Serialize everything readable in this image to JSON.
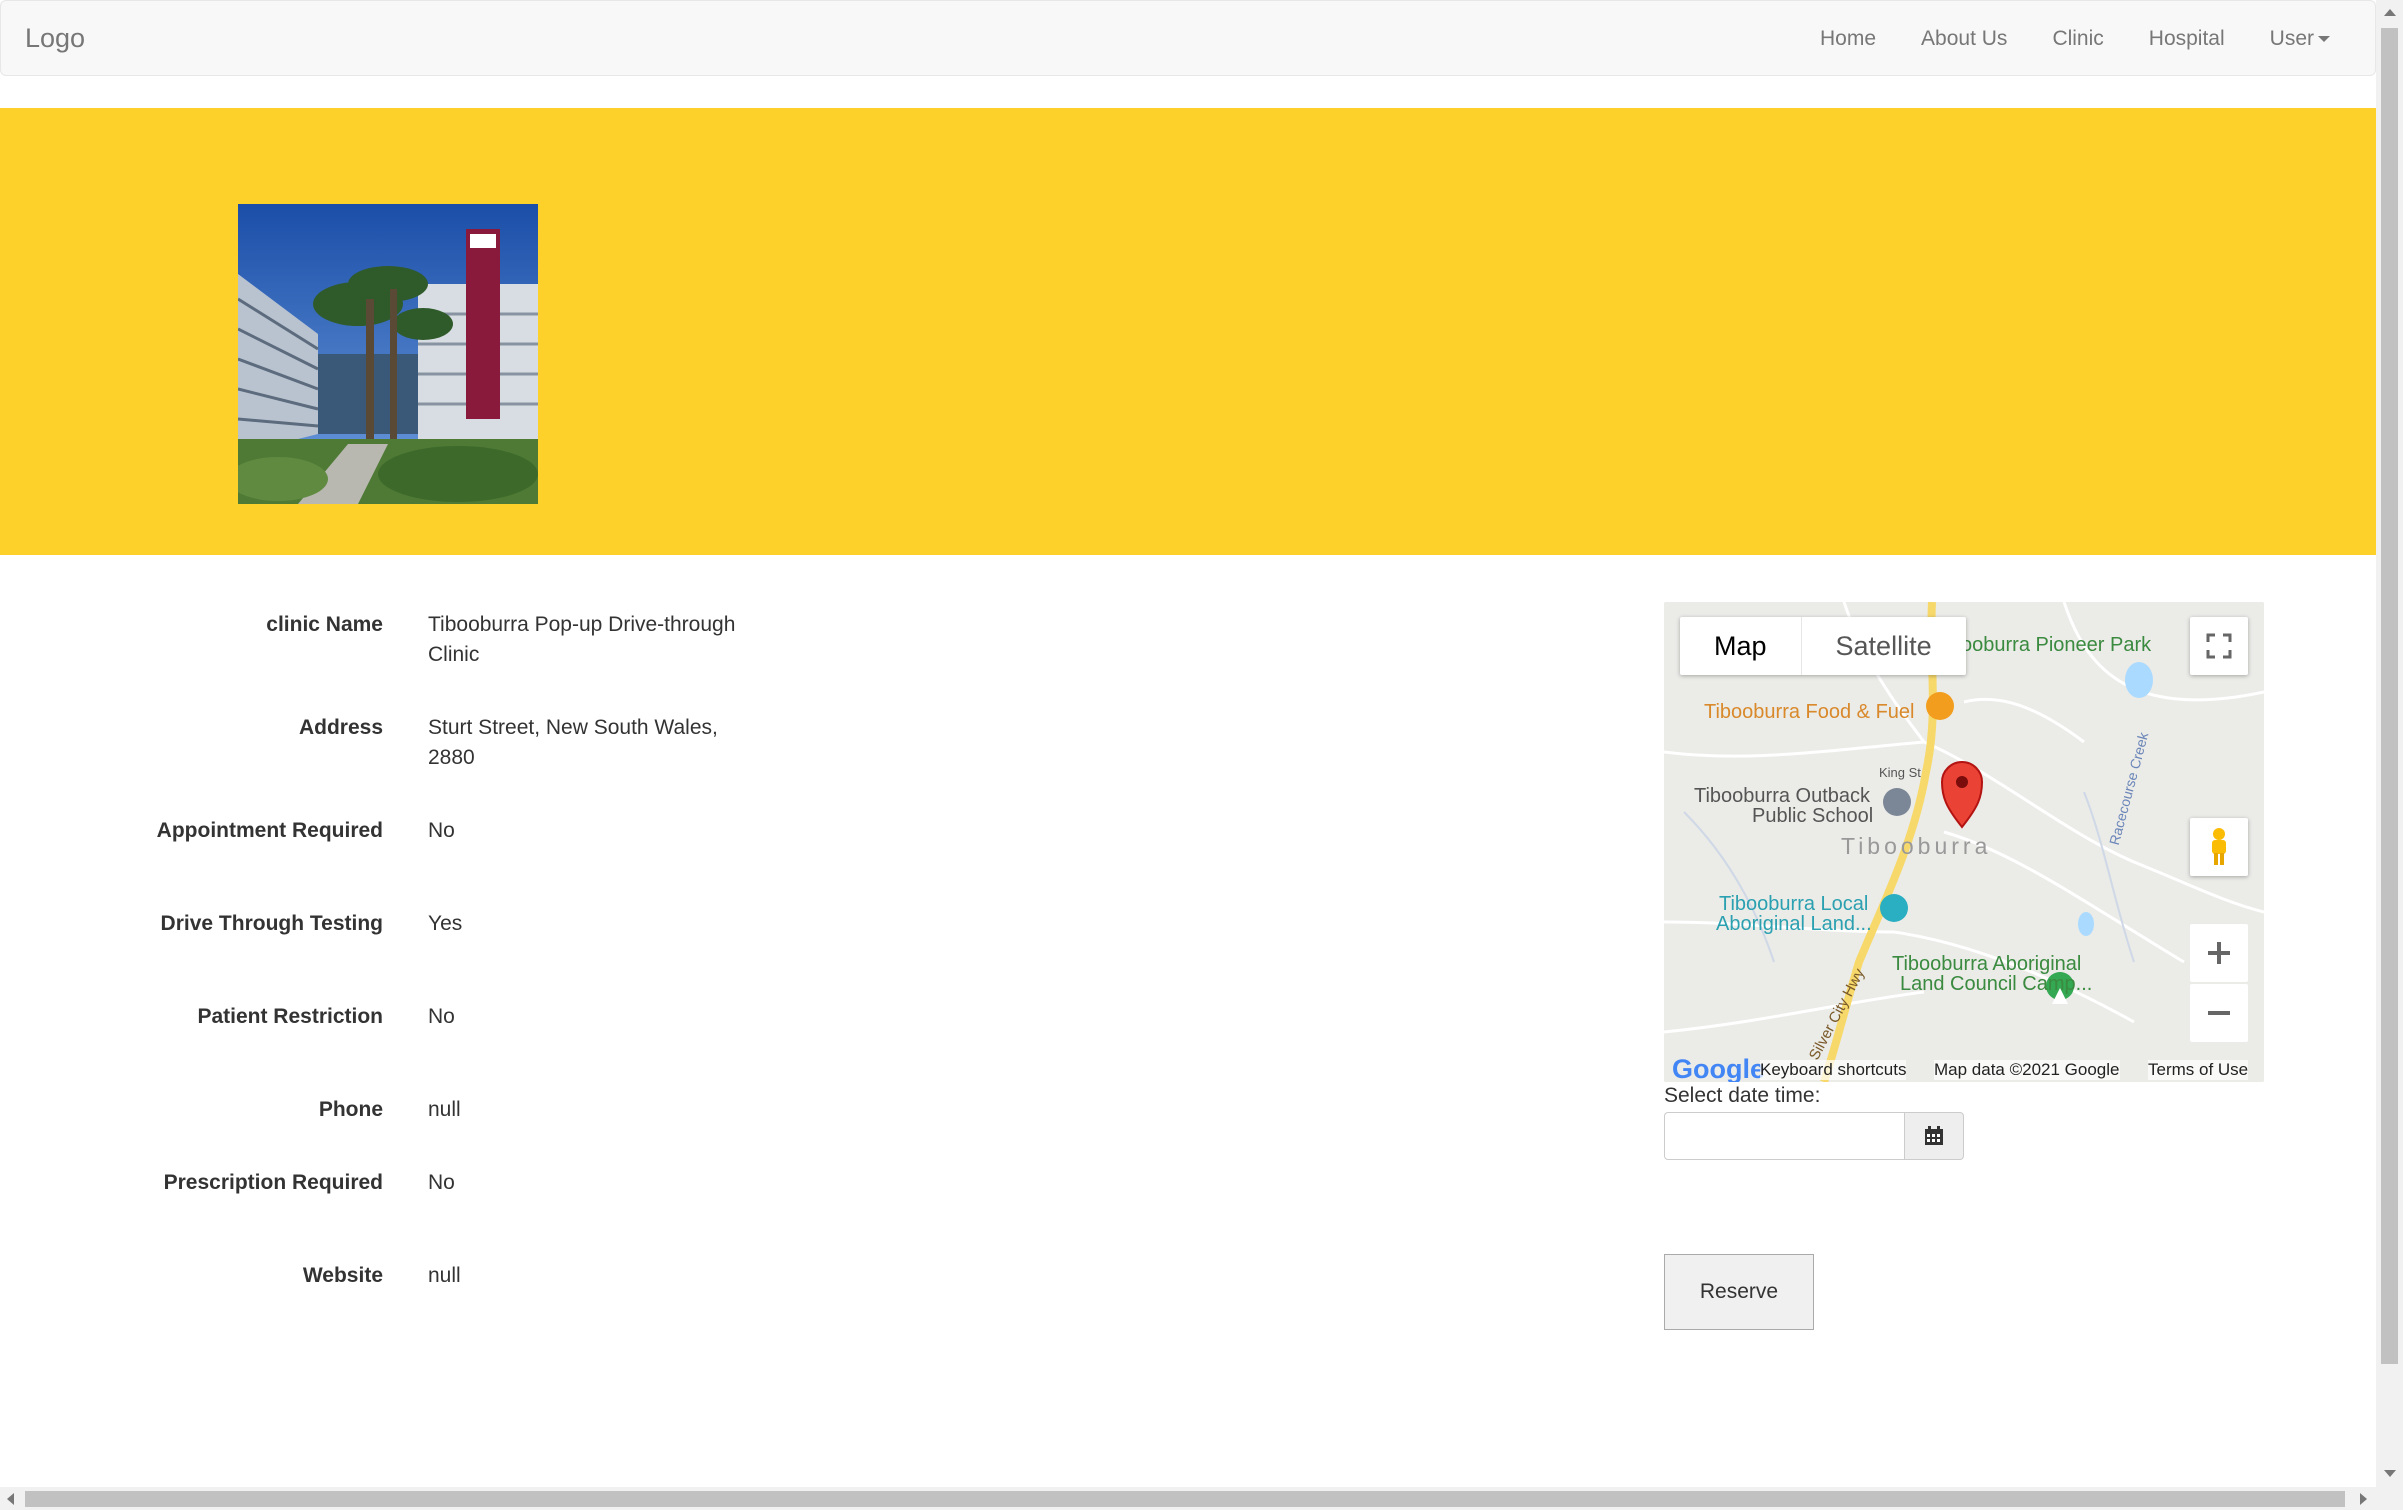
{
  "navbar": {
    "brand": "Logo",
    "links": [
      "Home",
      "About Us",
      "Clinic",
      "Hospital",
      "User"
    ]
  },
  "details": [
    {
      "label": "clinic Name",
      "value": "Tibooburra Pop-up Drive-through Clinic"
    },
    {
      "label": "Address",
      "value": "Sturt Street, New South Wales, 2880"
    },
    {
      "label": "Appointment Required",
      "value": "No"
    },
    {
      "label": "Drive Through Testing",
      "value": "Yes"
    },
    {
      "label": "Patient Restriction",
      "value": "No"
    },
    {
      "label": "Phone",
      "value": "null"
    },
    {
      "label": "Prescription Required",
      "value": "No"
    },
    {
      "label": "Website",
      "value": "null"
    }
  ],
  "map": {
    "type_buttons": [
      "Map",
      "Satellite"
    ],
    "labels": {
      "park": "ooburra Pioneer Park",
      "food": "Tibooburra Food & Fuel",
      "street": "King St",
      "school_1": "Tibooburra Outback",
      "school_2": "Public School",
      "town": "Tibooburra",
      "land_1": "Tibooburra Local",
      "land_2": "Aboriginal Land...",
      "camp_1": "Tibooburra Aboriginal",
      "camp_2": "Land Council Camp...",
      "creek": "Racecourse Creek",
      "highway": "Silver City Hwy"
    },
    "footer": {
      "logo": "Google",
      "shortcuts": "Keyboard shortcuts",
      "data": "Map data ©2021 Google",
      "terms": "Terms of Use"
    }
  },
  "reservation": {
    "date_label": "Select date time:",
    "date_value": "",
    "reserve_label": "Reserve"
  }
}
